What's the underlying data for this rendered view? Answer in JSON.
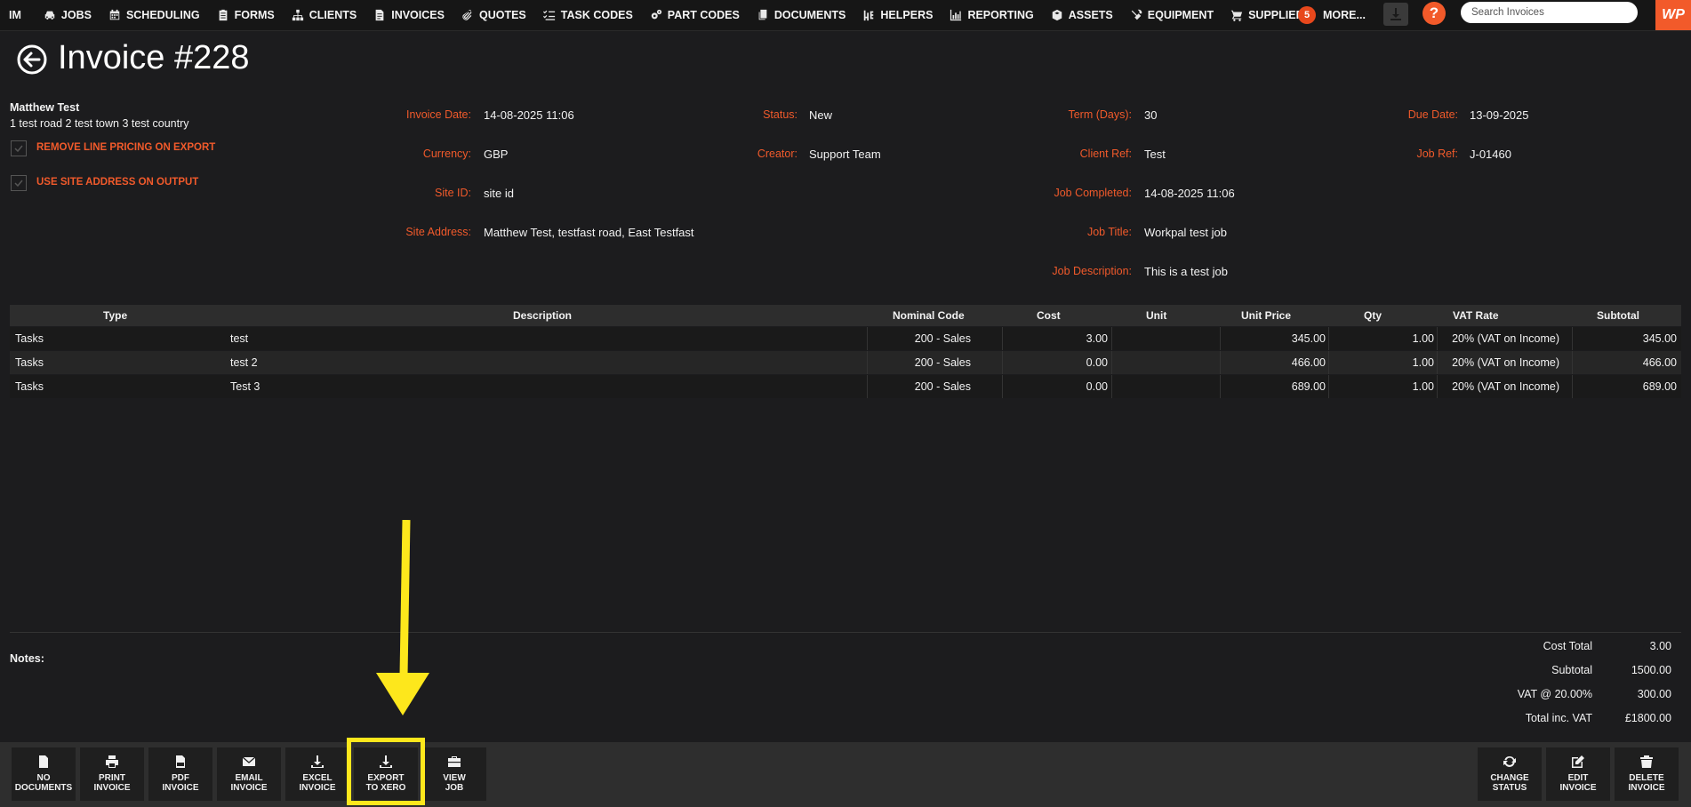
{
  "nav": {
    "brand": "IM",
    "items": [
      {
        "label": "JOBS",
        "icon": "car-icon"
      },
      {
        "label": "SCHEDULING",
        "icon": "calendar-icon"
      },
      {
        "label": "FORMS",
        "icon": "clipboard-icon"
      },
      {
        "label": "CLIENTS",
        "icon": "sitemap-icon"
      },
      {
        "label": "INVOICES",
        "icon": "file-invoice-icon"
      },
      {
        "label": "QUOTES",
        "icon": "paperclip-icon"
      },
      {
        "label": "TASK CODES",
        "icon": "list-check-icon"
      },
      {
        "label": "PART CODES",
        "icon": "cogs-icon"
      },
      {
        "label": "DOCUMENTS",
        "icon": "copy-icon"
      },
      {
        "label": "HELPERS",
        "icon": "helpers-icon"
      },
      {
        "label": "REPORTING",
        "icon": "chart-icon"
      },
      {
        "label": "ASSETS",
        "icon": "cube-icon"
      },
      {
        "label": "EQUIPMENT",
        "icon": "tools-icon"
      },
      {
        "label": "SUPPLIERS",
        "icon": "cart-icon"
      }
    ],
    "more_count": "5",
    "more_label": "MORE...",
    "search_placeholder": "Search Invoices",
    "help": "?",
    "logo": "WP",
    "accent_color": "#f15a2b"
  },
  "invoice": {
    "title": "Invoice #228",
    "client_name": "Matthew Test",
    "client_address": "1 test road 2 test town 3 test country",
    "options": [
      {
        "label": "REMOVE LINE PRICING ON EXPORT",
        "checked": true
      },
      {
        "label": "USE SITE ADDRESS ON OUTPUT",
        "checked": true
      }
    ],
    "fields": {
      "invoice_date": {
        "label": "Invoice Date:",
        "value": "14-08-2025 11:06"
      },
      "currency": {
        "label": "Currency:",
        "value": "GBP"
      },
      "site_id": {
        "label": "Site ID:",
        "value": "site id"
      },
      "site_address": {
        "label": "Site Address:",
        "value": "Matthew Test, testfast road, East Testfast"
      },
      "status": {
        "label": "Status:",
        "value": "New"
      },
      "creator": {
        "label": "Creator:",
        "value": "Support Team"
      },
      "term": {
        "label": "Term (Days):",
        "value": "30"
      },
      "client_ref": {
        "label": "Client Ref:",
        "value": "Test"
      },
      "job_completed": {
        "label": "Job Completed:",
        "value": "14-08-2025 11:06"
      },
      "job_title": {
        "label": "Job Title:",
        "value": "Workpal test job"
      },
      "job_description": {
        "label": "Job Description:",
        "value": "This is a test job"
      },
      "due_date": {
        "label": "Due Date:",
        "value": "13-09-2025"
      },
      "job_ref": {
        "label": "Job Ref:",
        "value": "J-01460"
      }
    }
  },
  "table": {
    "headers": [
      "Type",
      "Description",
      "Nominal Code",
      "Cost",
      "Unit",
      "Unit Price",
      "Qty",
      "VAT Rate",
      "Subtotal"
    ],
    "rows": [
      [
        "Tasks",
        "test",
        "200 - Sales",
        "3.00",
        "",
        "345.00",
        "1.00",
        "20% (VAT on Income)",
        "345.00"
      ],
      [
        "Tasks",
        "test 2",
        "200 - Sales",
        "0.00",
        "",
        "466.00",
        "1.00",
        "20% (VAT on Income)",
        "466.00"
      ],
      [
        "Tasks",
        "Test 3",
        "200 - Sales",
        "0.00",
        "",
        "689.00",
        "1.00",
        "20% (VAT on Income)",
        "689.00"
      ]
    ]
  },
  "notes_label": "Notes:",
  "totals": [
    {
      "label": "Cost Total",
      "value": "3.00"
    },
    {
      "label": "Subtotal",
      "value": "1500.00"
    },
    {
      "label": "VAT @ 20.00%",
      "value": "300.00"
    },
    {
      "label": "Total inc. VAT",
      "value": "£1800.00"
    }
  ],
  "toolbar": {
    "left": [
      {
        "line1": "NO",
        "line2": "DOCUMENTS",
        "icon": "file-icon"
      },
      {
        "line1": "PRINT",
        "line2": "INVOICE",
        "icon": "print-icon"
      },
      {
        "line1": "PDF",
        "line2": "INVOICE",
        "icon": "pdf-icon"
      },
      {
        "line1": "EMAIL",
        "line2": "INVOICE",
        "icon": "envelope-icon"
      },
      {
        "line1": "EXCEL",
        "line2": "INVOICE",
        "icon": "download-icon"
      },
      {
        "line1": "EXPORT",
        "line2": "TO XERO",
        "icon": "download-icon"
      },
      {
        "line1": "VIEW",
        "line2": "JOB",
        "icon": "toolbox-icon"
      }
    ],
    "right": [
      {
        "line1": "CHANGE",
        "line2": "STATUS",
        "icon": "sync-icon"
      },
      {
        "line1": "EDIT",
        "line2": "INVOICE",
        "icon": "edit-icon"
      },
      {
        "line1": "DELETE",
        "line2": "INVOICE",
        "icon": "trash-icon"
      }
    ],
    "highlight_color": "#fde71c"
  }
}
